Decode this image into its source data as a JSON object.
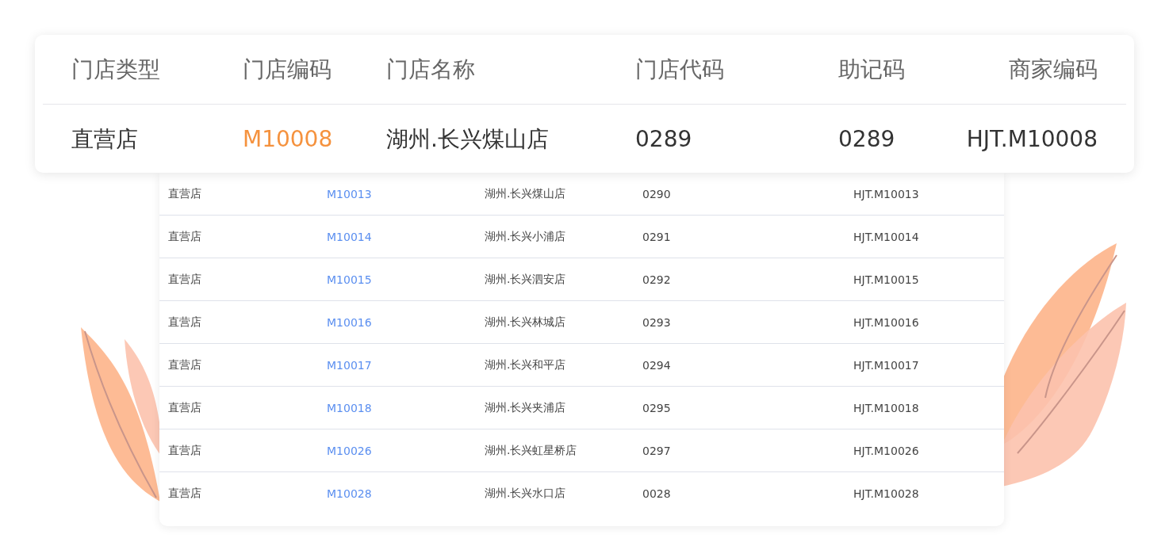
{
  "featured_table": {
    "columns": [
      "门店类型",
      "门店编码",
      "门店名称",
      "门店代码",
      "助记码",
      "商家编码"
    ],
    "row": [
      "直营店",
      "M10008",
      "湖州.长兴煤山店",
      "0289",
      "0289",
      "HJT.M10008"
    ]
  },
  "store_table": {
    "rows": [
      {
        "type": "直营店",
        "code": "M10013",
        "name": "湖州.长兴煤山店",
        "store_code": "0290",
        "merchant_code": "HJT.M10013"
      },
      {
        "type": "直营店",
        "code": "M10014",
        "name": "湖州.长兴小浦店",
        "store_code": "0291",
        "merchant_code": "HJT.M10014"
      },
      {
        "type": "直营店",
        "code": "M10015",
        "name": "湖州.长兴泗安店",
        "store_code": "0292",
        "merchant_code": "HJT.M10015"
      },
      {
        "type": "直营店",
        "code": "M10016",
        "name": "湖州.长兴林城店",
        "store_code": "0293",
        "merchant_code": "HJT.M10016"
      },
      {
        "type": "直营店",
        "code": "M10017",
        "name": "湖州.长兴和平店",
        "store_code": "0294",
        "merchant_code": "HJT.M10017"
      },
      {
        "type": "直营店",
        "code": "M10018",
        "name": "湖州.长兴夹浦店",
        "store_code": "0295",
        "merchant_code": "HJT.M10018"
      },
      {
        "type": "直营店",
        "code": "M10026",
        "name": "湖州.长兴虹星桥店",
        "store_code": "0297",
        "merchant_code": "HJT.M10026"
      },
      {
        "type": "直营店",
        "code": "M10028",
        "name": "湖州.长兴水口店",
        "store_code": "0028",
        "merchant_code": "HJT.M10028"
      }
    ]
  }
}
